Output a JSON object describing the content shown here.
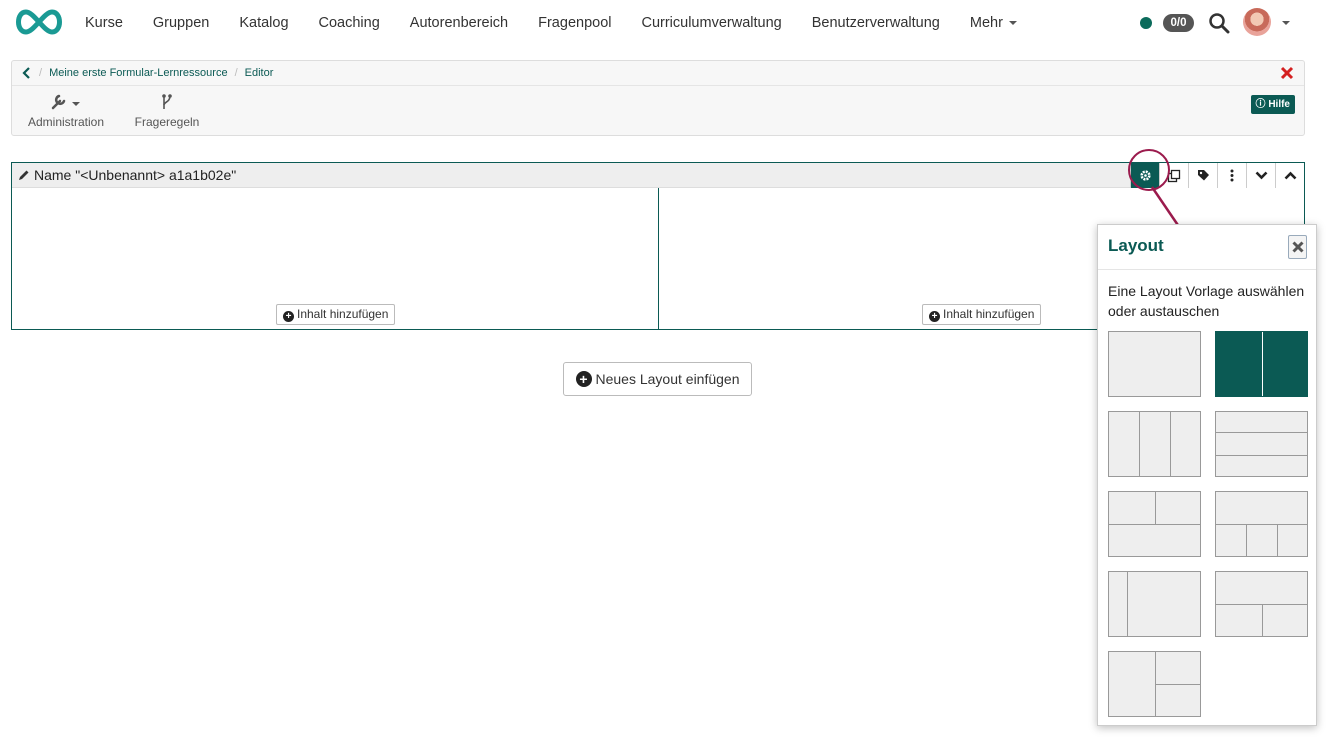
{
  "nav": {
    "items": [
      "Kurse",
      "Gruppen",
      "Katalog",
      "Coaching",
      "Autorenbereich",
      "Fragenpool",
      "Curriculumverwaltung",
      "Benutzerverwaltung",
      "Mehr"
    ],
    "badge": "0/0",
    "status_color": "#0b6b5b"
  },
  "breadcrumb": {
    "items": [
      "Meine erste Formular-Lernressource",
      "Editor"
    ]
  },
  "toolbar": {
    "administration": "Administration",
    "frageregeln": "Frageregeln",
    "help": "Hilfe"
  },
  "container": {
    "title": "Name \"<Unbenannt> a1a1b02e\"",
    "add_content_left": "Inhalt hinzufügen",
    "add_content_right": "Inhalt hinzufügen",
    "tools": [
      "gear-icon",
      "copy-icon",
      "tag-icon",
      "more-icon",
      "chevron-down-icon",
      "chevron-up-icon"
    ]
  },
  "new_layout_button": "Neues Layout einfügen",
  "popover": {
    "title": "Layout",
    "description": "Eine Layout Vorlage auswählen oder austauschen",
    "templates": [
      "single",
      "two-columns",
      "three-columns",
      "three-rows",
      "header-two-columns-footer",
      "header-three-columns",
      "sidebar-left",
      "header-two-columns",
      "sidebar-right-split"
    ],
    "selected": "two-columns"
  },
  "colors": {
    "accent": "#0b5a54",
    "highlight": "#9b1b4d",
    "close_red": "#d42020"
  }
}
